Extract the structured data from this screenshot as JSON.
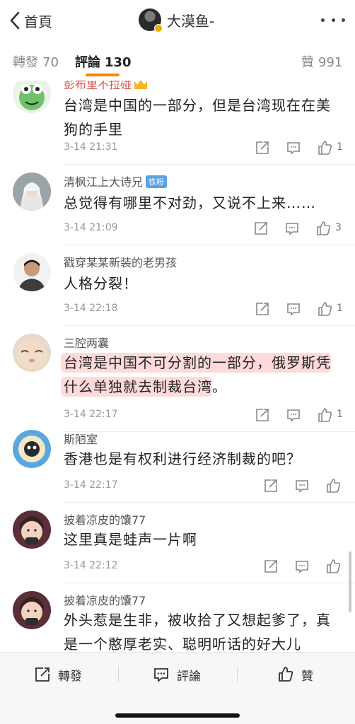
{
  "header": {
    "back_label": "首頁",
    "author_name": "大漠鱼-",
    "more_icon": "more-dots-icon"
  },
  "tabs": [
    {
      "label": "轉發",
      "count": "70",
      "active": false
    },
    {
      "label": "評論",
      "count": "130",
      "active": true
    },
    {
      "label": "贊",
      "count": "991",
      "active": false
    }
  ],
  "colors": {
    "accent": "#ff8200",
    "highlight": "#ff9696",
    "badge": "#5aa0e6"
  },
  "comments": [
    {
      "name": "彭布里不拉碰",
      "text": "台湾是中国的一部分，但是台湾现在在美狗的手里",
      "time": "3-14 21:31",
      "likes": "1"
    },
    {
      "name": "清枫江上大诗兄",
      "badge": "铁粉",
      "text": "总觉得有哪里不对劲，又说不上来……",
      "time": "3-14 21:09",
      "likes": "3"
    },
    {
      "name": "戳穿某某新装的老男孩",
      "text": "人格分裂！",
      "time": "3-14 22:18",
      "likes": "1"
    },
    {
      "name": "三腔两囊",
      "text_line1": "台湾是中国不可分割的一部分，俄罗斯凭",
      "text_line2": "什么单独就去制裁台湾",
      "text_end": "。",
      "time": "3-14 22:17",
      "likes": "1"
    },
    {
      "name": "斯陋室",
      "text": "香港也是有权利进行经济制裁的吧？",
      "time": "3-14 22:17",
      "likes": ""
    },
    {
      "name": "披着凉皮的馕77",
      "text": "这里真是蛙声一片啊",
      "time": "3-14 22:12",
      "likes": ""
    },
    {
      "name": "披着凉皮的馕77",
      "text": "外头惹是生非，被收拾了又想起爹了，真是一个憨厚老实、聪明听话的好大儿",
      "time": "",
      "likes": ""
    }
  ],
  "bottom_bar": {
    "repost_label": "轉發",
    "comment_label": "評論",
    "like_label": "贊"
  }
}
